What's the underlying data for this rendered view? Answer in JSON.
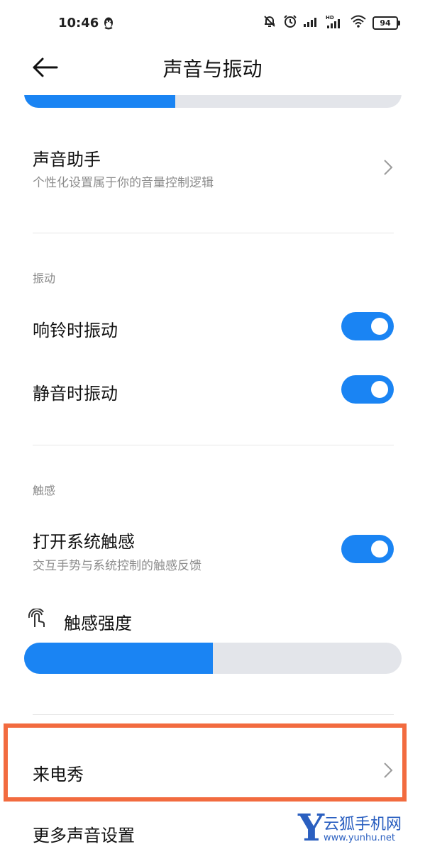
{
  "status": {
    "time": "10:46",
    "battery": "94",
    "icons": [
      "qq-icon",
      "bell-off-icon",
      "alarm-icon",
      "signal-icon",
      "hd-signal-icon",
      "wifi-icon",
      "battery-icon"
    ]
  },
  "header": {
    "title": "声音与振动",
    "back_icon": "arrow-left-icon"
  },
  "top_volume_slider": {
    "level_percent": 40,
    "fill_color": "#1a84f3",
    "track_color": "#e3e5ea"
  },
  "sound_assistant": {
    "title": "声音助手",
    "subtitle": "个性化设置属于你的音量控制逻辑"
  },
  "vibration": {
    "section_label": "振动",
    "items": [
      {
        "label": "响铃时振动",
        "enabled": true
      },
      {
        "label": "静音时振动",
        "enabled": true
      }
    ]
  },
  "haptics": {
    "section_label": "触感",
    "system_haptics": {
      "title": "打开系统触感",
      "subtitle": "交互手势与系统控制的触感反馈",
      "enabled": true
    },
    "intensity": {
      "label": "触感强度",
      "level_percent": 50,
      "icon": "haptic-finger-icon"
    }
  },
  "caller_show": {
    "title": "来电秀"
  },
  "more_sound": {
    "title": "更多声音设置"
  },
  "accent_color": "#1a84f3",
  "highlight_color": "#f26b3f",
  "watermark": {
    "letter": "Y",
    "name": "云狐手机网",
    "url": "www.yunhu.net"
  }
}
